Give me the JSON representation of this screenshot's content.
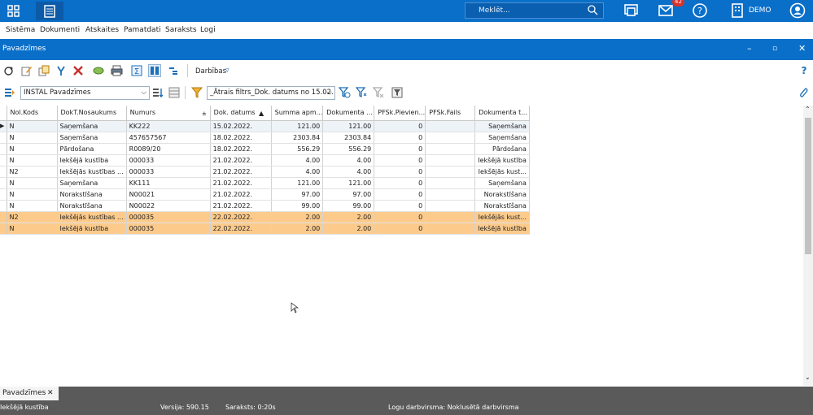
{
  "topbar": {
    "search_placeholder": "Meklēt...",
    "notifications_count": "42",
    "user": "DEMO",
    "accent": "#0a6fc9"
  },
  "menu": [
    "Sistēma",
    "Dokumenti",
    "Atskaites",
    "Pamatdati",
    "Saraksts",
    "Logi"
  ],
  "window": {
    "title": "Pavadzīmes"
  },
  "toolbar": {
    "actions_label": "Darbības"
  },
  "filter": {
    "layout_value": "INSTAL Pavadzīmes",
    "filter_value": "_Ātrais filtrs_Dok. datums no 15.02."
  },
  "grid": {
    "columns": [
      "Nol.Kods",
      "DokT.Nosaukums",
      "Numurs",
      "Dok. datums",
      "Summa apm...",
      "Dokumenta ...",
      "PFSk.Pievien...",
      "PFSk.Fails",
      "Dokumenta t..."
    ],
    "rows": [
      [
        "N",
        "Saņemšana",
        "KK222",
        "15.02.2022.",
        "121.00",
        "121.00",
        "0",
        "",
        "Saņemšana"
      ],
      [
        "N",
        "Saņemšana",
        "457657567",
        "18.02.2022.",
        "2303.84",
        "2303.84",
        "0",
        "",
        "Saņemšana"
      ],
      [
        "N",
        "Pārdošana",
        "R0089/20",
        "18.02.2022.",
        "556.29",
        "556.29",
        "0",
        "",
        "Pārdošana"
      ],
      [
        "N",
        "Iekšējā kustība",
        "000033",
        "21.02.2022.",
        "4.00",
        "4.00",
        "0",
        "",
        "Iekšējā kustība"
      ],
      [
        "N2",
        "Iekšējās kustības ...",
        "000033",
        "21.02.2022.",
        "4.00",
        "4.00",
        "0",
        "",
        "Iekšējās kust..."
      ],
      [
        "N",
        "Saņemšana",
        "KK111",
        "21.02.2022.",
        "121.00",
        "121.00",
        "0",
        "",
        "Saņemšana"
      ],
      [
        "N",
        "Norakstīšana",
        "N00021",
        "21.02.2022.",
        "97.00",
        "97.00",
        "0",
        "",
        "Norakstīšana"
      ],
      [
        "N",
        "Norakstīšana",
        "N00022",
        "21.02.2022.",
        "99.00",
        "99.00",
        "0",
        "",
        "Norakstīšana"
      ],
      [
        "N2",
        "Iekšējās kustības ...",
        "000035",
        "22.02.2022.",
        "2.00",
        "2.00",
        "0",
        "",
        "Iekšējās kust..."
      ],
      [
        "N",
        "Iekšējā kustība",
        "000035",
        "22.02.2022.",
        "2.00",
        "2.00",
        "0",
        "",
        "Iekšējā kustība"
      ]
    ],
    "highlight_color": "#fccb8c"
  },
  "tab": {
    "label": "Pavadzīmes"
  },
  "status": {
    "left": "Iekšējā kustība",
    "version": "Versija: 590.15",
    "list": "Saraksts: 0:20s",
    "log": "Logu darbvirsma: Noklusētā darbvirsma"
  }
}
